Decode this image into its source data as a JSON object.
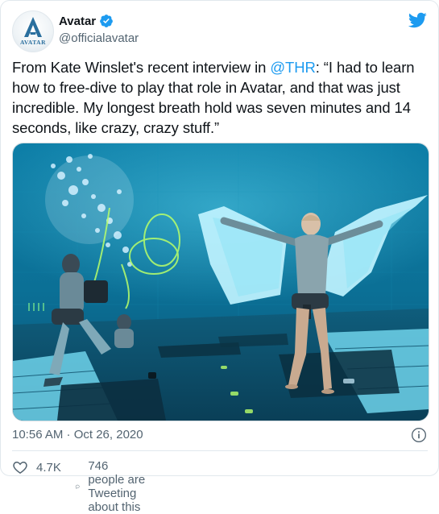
{
  "account": {
    "display_name": "Avatar",
    "handle": "@officialavatar",
    "avatar_text": "AVATAR",
    "verified": true
  },
  "tweet": {
    "text_before": "From Kate Winslet's recent interview in ",
    "mention": "@THR",
    "text_after": ": “I had to learn how to free-dive to play that role in Avatar, and that was just incredible. My longest breath hold was seven minutes and 14 seconds, like crazy, crazy stuff.”",
    "timestamp": "10:56 AM · Oct 26, 2020"
  },
  "engagement": {
    "likes": "4.7K",
    "reply_text": "746 people are Tweeting about this"
  },
  "icons": {
    "brand": "twitter-bird-icon",
    "verified": "verified-badge-icon",
    "info": "info-icon",
    "like": "heart-icon",
    "reply": "speech-bubble-icon"
  },
  "colors": {
    "accent": "#1d9bf0",
    "text": "#0f1419",
    "secondary": "#536471",
    "water": "#1aa6c8"
  }
}
